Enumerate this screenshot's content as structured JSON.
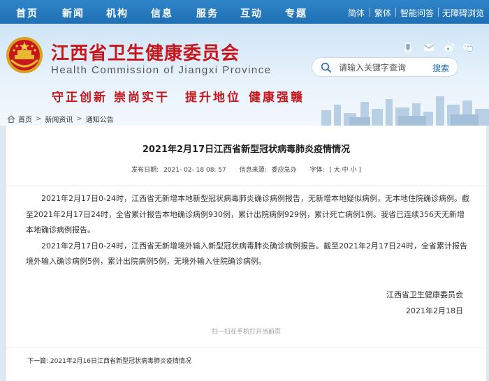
{
  "topnav": {
    "items": [
      "首页",
      "新闻",
      "机构",
      "信息",
      "服务",
      "互动",
      "专题"
    ],
    "utilities": [
      "简体",
      "繁体",
      "智能问答",
      "无障碍浏览"
    ]
  },
  "header": {
    "title": "江西省卫生健康委员会",
    "subtitle": "Health Commission of Jiangxi Province",
    "slogans": [
      "守正创新",
      "崇尚实干",
      "提升地位",
      "健康强赣"
    ],
    "social_icons": [
      "mobile-icon",
      "mail-icon",
      "weibo-icon",
      "wechat-icon"
    ]
  },
  "search": {
    "placeholder": "请输入关键字查询",
    "button": "搜索"
  },
  "breadcrumb": {
    "items": [
      "首页",
      "新闻资讯",
      "通知公告"
    ],
    "separator": ">"
  },
  "article": {
    "title": "2021年2月17日江西省新型冠状病毒肺炎疫情情况",
    "meta": {
      "date_label": "发布日期:",
      "date_value": "2021- 02- 18 08: 57",
      "source_label": "信息来源:",
      "source_value": "委应急办",
      "fontsize_label": "字体:",
      "fontsize_options": "[ 大 中 小 ]"
    },
    "paragraphs": [
      "2021年2月17日0-24时，江西省无新增本地新型冠状病毒肺炎确诊病例报告，无新增本地疑似病例，无本地住院确诊病例。截至2021年2月17日24时，全省累计报告本地确诊病例930例，累计出院病例929例，累计死亡病例1例。我省已连续356天无新增本地确诊病例报告。",
      "2021年2月17日0-24时，江西省无新增境外输入新型冠状病毒肺炎确诊病例报告。截至2021年2月17日24时，全省累计报告境外输入确诊病例5例，累计出院病例5例，无境外输入住院确诊病例。"
    ],
    "signature": "江西省卫生健康委员会",
    "sign_date": "2021年2月18日",
    "qr_hint": "扫一扫在手机打开当前页",
    "prev_label": "下一篇:",
    "prev_title": "2021年2月16日江西省新型冠状病毒肺炎疫情情况"
  },
  "colors": {
    "nav_blue": "#1f6fb3",
    "brand_red": "#c8161d"
  }
}
